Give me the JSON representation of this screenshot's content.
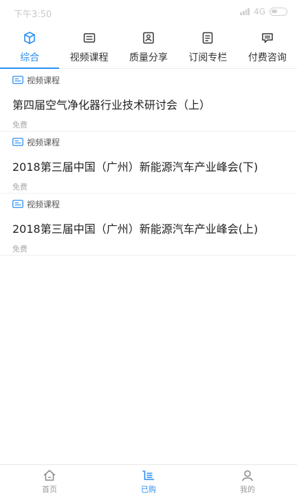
{
  "status_bar": {
    "time": "下午3:50",
    "network": "4G"
  },
  "colors": {
    "accent": "#2a8ef2",
    "text": "#222222",
    "muted": "#a8a8a8",
    "icon": "#333333"
  },
  "tabs": [
    {
      "label": "综合",
      "icon": "cube-icon",
      "active": true
    },
    {
      "label": "视频课程",
      "icon": "video-icon",
      "active": false
    },
    {
      "label": "质量分享",
      "icon": "share-icon",
      "active": false
    },
    {
      "label": "订阅专栏",
      "icon": "document-icon",
      "active": false
    },
    {
      "label": "付费咨询",
      "icon": "chat-icon",
      "active": false
    }
  ],
  "items": [
    {
      "type": "视频课程",
      "title": "第四届空气净化器行业技术研讨会（上）",
      "price": "免费"
    },
    {
      "type": "视频课程",
      "title": "2018第三届中国（广州）新能源汽车产业峰会(下)",
      "price": "免费"
    },
    {
      "type": "视频课程",
      "title": "2018第三届中国（广州）新能源汽车产业峰会(上)",
      "price": "免费"
    }
  ],
  "bottom_nav": [
    {
      "label": "首页",
      "icon": "home-icon",
      "active": false
    },
    {
      "label": "已购",
      "icon": "purchased-icon",
      "active": true
    },
    {
      "label": "我的",
      "icon": "profile-icon",
      "active": false
    }
  ]
}
